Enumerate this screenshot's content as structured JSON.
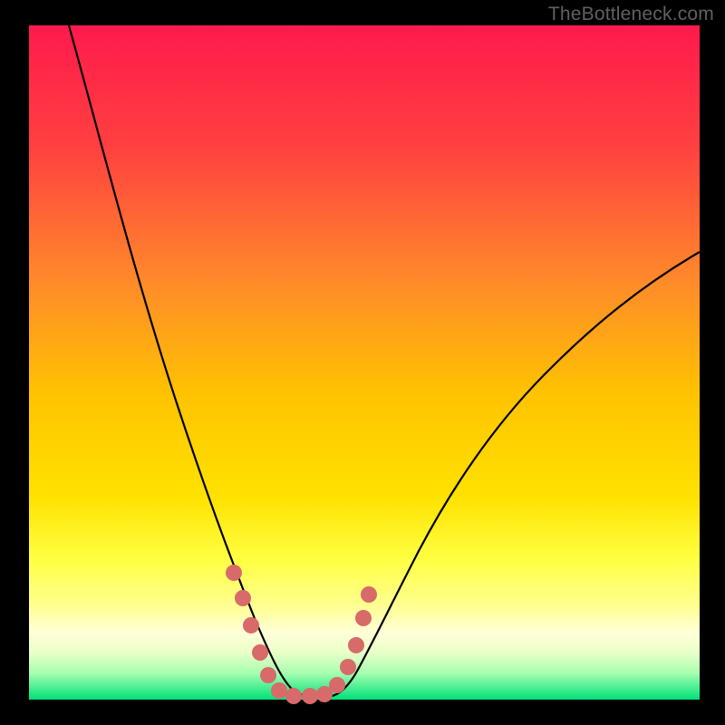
{
  "watermark": "TheBottleneck.com",
  "colors": {
    "frame": "#000000",
    "gradient_top": "#ff1a4d",
    "gradient_mid1": "#ff6a2a",
    "gradient_mid2": "#ffd400",
    "gradient_mid3": "#ffff60",
    "gradient_low1": "#ffffc0",
    "gradient_low2": "#d8ffc0",
    "gradient_bottom": "#00e07a",
    "curve": "#000000",
    "marker": "#d86a6a"
  },
  "chart_data": {
    "type": "line",
    "title": "",
    "xlabel": "",
    "ylabel": "",
    "xlim": [
      0,
      100
    ],
    "ylim": [
      0,
      100
    ],
    "series": [
      {
        "name": "bottleneck-curve",
        "x": [
          6,
          10,
          15,
          20,
          25,
          28,
          30,
          32,
          34,
          36,
          38,
          40,
          43,
          46,
          50,
          55,
          60,
          65,
          70,
          75,
          80,
          85,
          90,
          95,
          100
        ],
        "y": [
          100,
          87,
          72,
          57,
          40,
          28,
          20,
          12,
          6,
          2,
          0,
          0,
          0,
          3,
          9,
          18,
          27,
          35,
          42,
          48,
          53,
          58,
          62,
          65,
          68
        ]
      }
    ],
    "markers": {
      "name": "highlight-points",
      "x": [
        30.5,
        31.8,
        33.2,
        34.8,
        37.0,
        39.5,
        42.0,
        44.0,
        45.5,
        46.8,
        47.8
      ],
      "y": [
        18,
        12,
        7,
        3,
        0.5,
        0.3,
        0.5,
        2,
        5,
        10,
        15
      ]
    },
    "optimal_x": 40,
    "annotations": []
  }
}
